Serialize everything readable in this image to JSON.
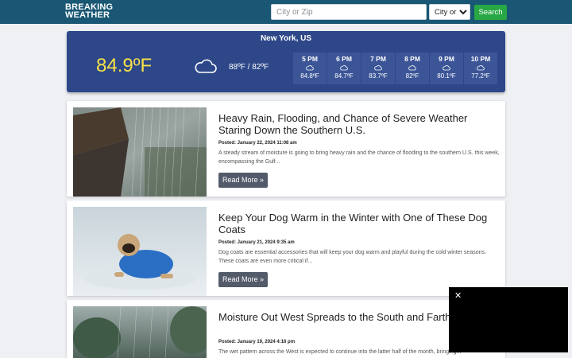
{
  "header": {
    "logo_line1": "BREAKING",
    "logo_line2": "WEATHER",
    "search_placeholder": "City or Zip",
    "search_mode_selected": "City or Zip",
    "search_button": "Search"
  },
  "weather": {
    "location": "New York, US",
    "current_temp": "84.9ºF",
    "condition_icon": "cloud-icon",
    "high_low": "88ºF / 82ºF",
    "hourly": [
      {
        "time": "5 PM",
        "temp": "84.8ºF",
        "icon": "cloud-icon"
      },
      {
        "time": "6 PM",
        "temp": "84.7ºF",
        "icon": "cloud-icon"
      },
      {
        "time": "7 PM",
        "temp": "83.7ºF",
        "icon": "cloud-icon"
      },
      {
        "time": "8 PM",
        "temp": "82ºF",
        "icon": "cloud-icon"
      },
      {
        "time": "9 PM",
        "temp": "80.1ºF",
        "icon": "cloud-icon"
      },
      {
        "time": "10 PM",
        "temp": "77.2ºF",
        "icon": "cloud-icon"
      }
    ]
  },
  "articles": [
    {
      "title": "Heavy Rain, Flooding, and Chance of Severe Weather Staring Down the Southern U.S.",
      "posted": "Posted: January 22, 2024 11:08 am",
      "excerpt": "A steady stream of moisture is going to bring heavy rain and the chance of flooding to the southern U.S. this week, encompassing the Gulf...",
      "button": "Read More »"
    },
    {
      "title": "Keep Your Dog Warm in the Winter with One of These Dog Coats",
      "posted": "Posted: January 21, 2024 9:35 am",
      "excerpt": "Dog coats are essential accessories that will keep your dog warm and playful during the cold winter seasons. These coats are even more critical if...",
      "button": "Read More »"
    },
    {
      "title": "Moisture Out West Spreads to the South and Farther Inland",
      "posted": "Posted: January 19, 2024 4:16 pm",
      "excerpt": "The wet pattern across the West is expected to continue into the latter half of the month, bringing..."
    }
  ],
  "overlay": {
    "close_glyph": "✕"
  }
}
